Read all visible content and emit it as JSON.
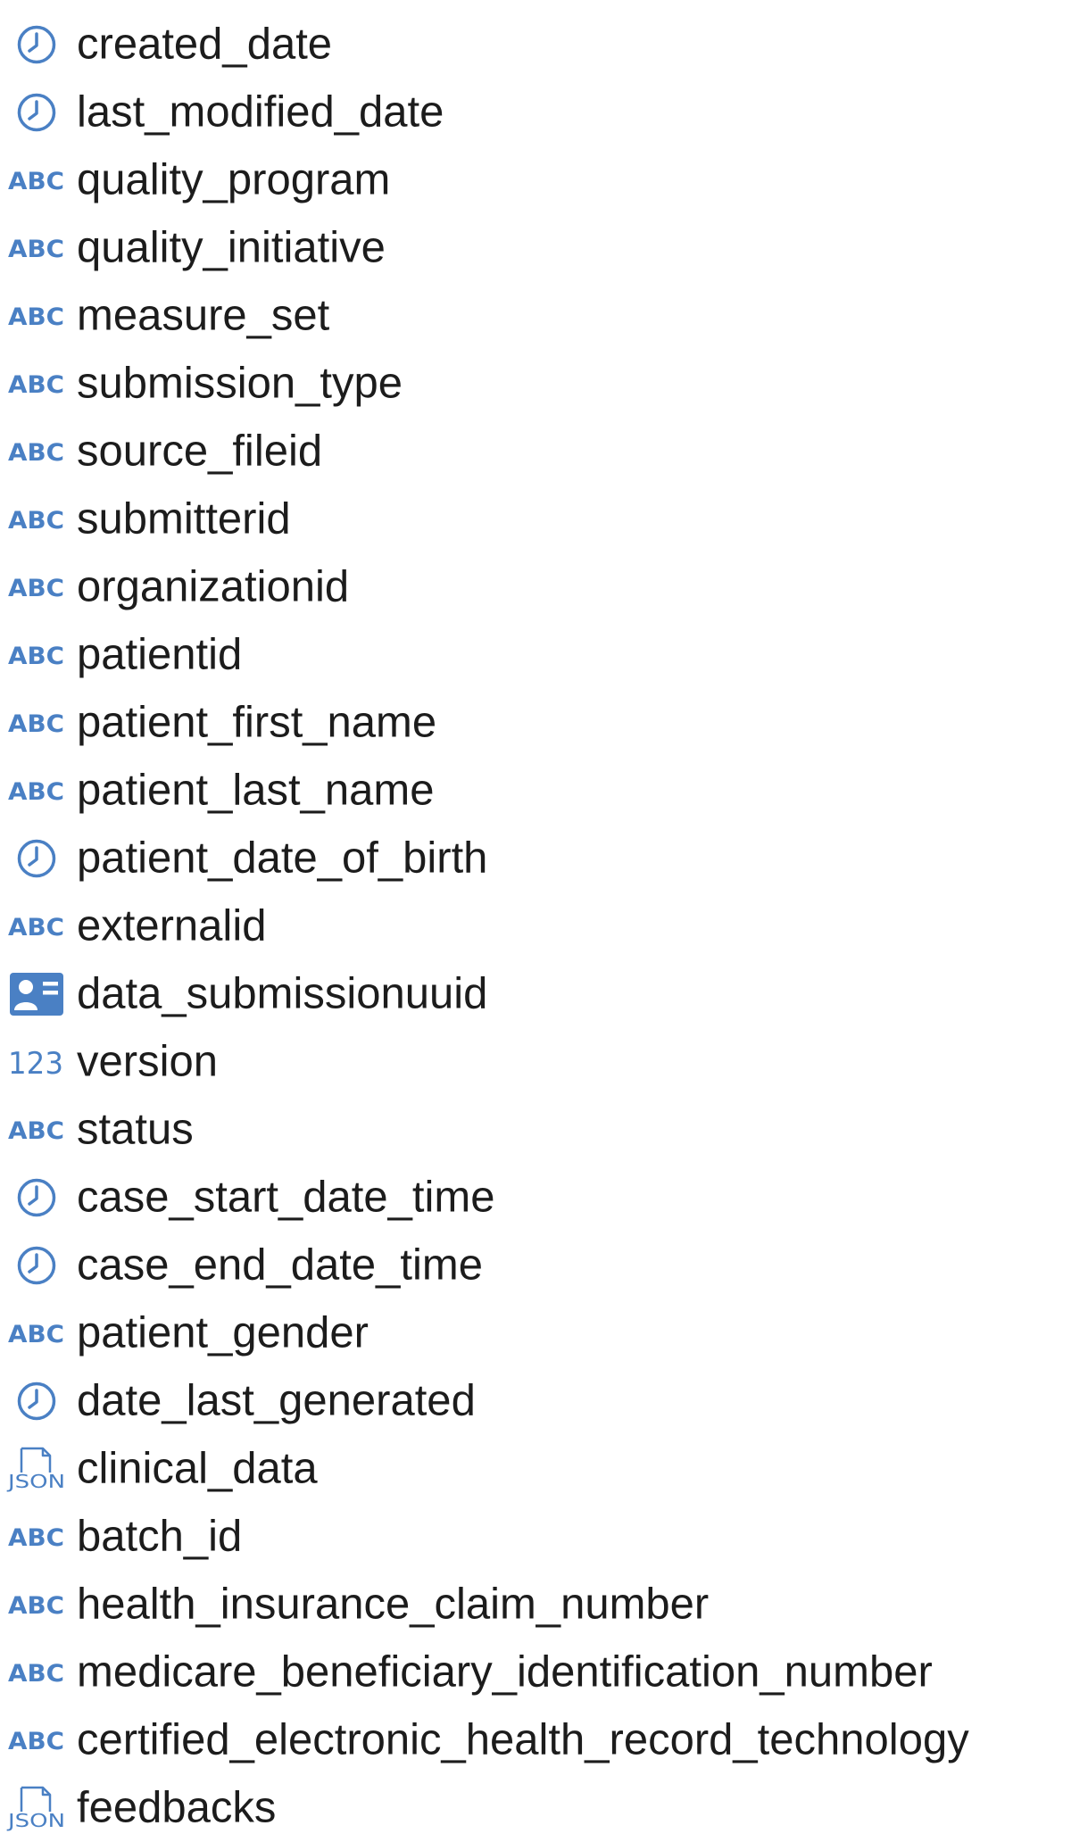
{
  "colors": {
    "icon": "#4a80c4",
    "text": "#1c1c1c",
    "background": "#ffffff"
  },
  "columns": [
    {
      "name": "created_date",
      "type": "clock-icon"
    },
    {
      "name": "last_modified_date",
      "type": "clock-icon"
    },
    {
      "name": "quality_program",
      "type": "abc-icon"
    },
    {
      "name": "quality_initiative",
      "type": "abc-icon"
    },
    {
      "name": "measure_set",
      "type": "abc-icon"
    },
    {
      "name": "submission_type",
      "type": "abc-icon"
    },
    {
      "name": "source_fileid",
      "type": "abc-icon"
    },
    {
      "name": "submitterid",
      "type": "abc-icon"
    },
    {
      "name": "organizationid",
      "type": "abc-icon"
    },
    {
      "name": "patientid",
      "type": "abc-icon"
    },
    {
      "name": "patient_first_name",
      "type": "abc-icon"
    },
    {
      "name": "patient_last_name",
      "type": "abc-icon"
    },
    {
      "name": "patient_date_of_birth",
      "type": "clock-icon"
    },
    {
      "name": "externalid",
      "type": "abc-icon"
    },
    {
      "name": "data_submissionuuid",
      "type": "id-card-icon"
    },
    {
      "name": "version",
      "type": "number-icon"
    },
    {
      "name": "status",
      "type": "abc-icon"
    },
    {
      "name": "case_start_date_time",
      "type": "clock-icon"
    },
    {
      "name": "case_end_date_time",
      "type": "clock-icon"
    },
    {
      "name": "patient_gender",
      "type": "abc-icon"
    },
    {
      "name": "date_last_generated",
      "type": "clock-icon"
    },
    {
      "name": "clinical_data",
      "type": "json-icon"
    },
    {
      "name": "batch_id",
      "type": "abc-icon"
    },
    {
      "name": "health_insurance_claim_number",
      "type": "abc-icon"
    },
    {
      "name": "medicare_beneficiary_identification_number",
      "type": "abc-icon"
    },
    {
      "name": "certified_electronic_health_record_technology",
      "type": "abc-icon"
    },
    {
      "name": "feedbacks",
      "type": "json-icon"
    }
  ],
  "glyphs": {
    "abc": "ABC",
    "number": "123",
    "json": "JSON"
  }
}
